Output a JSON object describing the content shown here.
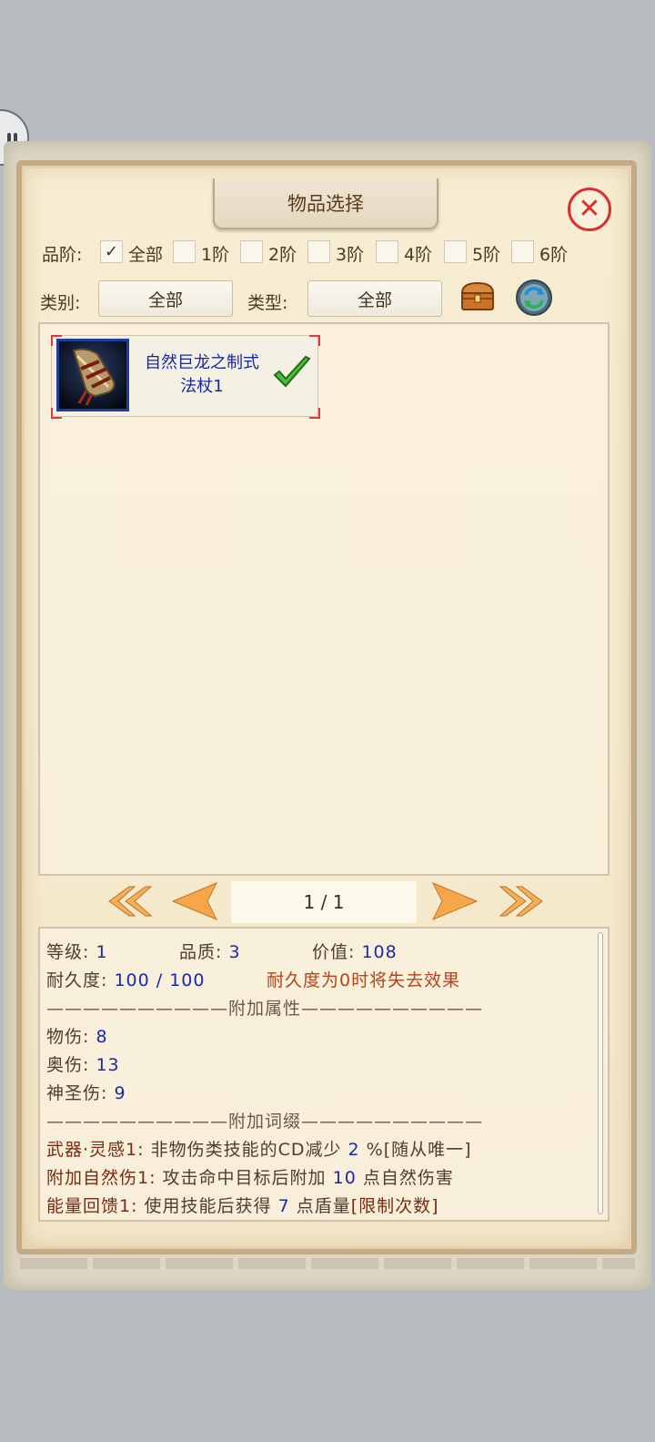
{
  "dialog": {
    "title": "物品选择",
    "close_icon": "✕"
  },
  "filters": {
    "grade_label": "品阶:",
    "grades": [
      {
        "label": "全部",
        "checked": true
      },
      {
        "label": "1阶",
        "checked": false
      },
      {
        "label": "2阶",
        "checked": false
      },
      {
        "label": "3阶",
        "checked": false
      },
      {
        "label": "4阶",
        "checked": false
      },
      {
        "label": "5阶",
        "checked": false
      },
      {
        "label": "6阶",
        "checked": false
      }
    ],
    "category_label": "类别:",
    "category_value": "全部",
    "type_label": "类型:",
    "type_value": "全部",
    "tools": [
      "chest-icon",
      "refresh-icon"
    ]
  },
  "items": [
    {
      "name_line1": "自然巨龙之制式",
      "name_line2": "法杖1",
      "selected": true,
      "icon": "staff-icon"
    }
  ],
  "pagination": {
    "text": "1 / 1"
  },
  "details": {
    "level_label": "等级:",
    "level": "1",
    "quality_label": "品质:",
    "quality": "3",
    "value_label": "价值:",
    "value": "108",
    "durability_label": "耐久度:",
    "durability": "100 / 100",
    "durability_warning": "耐久度为0时将失去效果",
    "section_attrs": "——————————附加属性——————————",
    "attrs": [
      {
        "label": "物伤:",
        "value": "8"
      },
      {
        "label": "奥伤:",
        "value": "13"
      },
      {
        "label": "神圣伤:",
        "value": "9"
      }
    ],
    "section_affix": "——————————附加词缀——————————",
    "affixes": [
      {
        "name": "武器·灵感1:",
        "pre": "非物伤类技能的CD减少",
        "num": "2",
        "post": "%",
        "tag": "[随从唯一]"
      },
      {
        "name": "附加自然伤1:",
        "pre": "攻击命中目标后附加",
        "num": "10",
        "post": "点自然伤害",
        "tag": ""
      },
      {
        "name": "能量回馈1:",
        "pre": "使用技能后获得",
        "num": "7",
        "post": "点盾量",
        "tag": "[限制次数]"
      }
    ]
  }
}
